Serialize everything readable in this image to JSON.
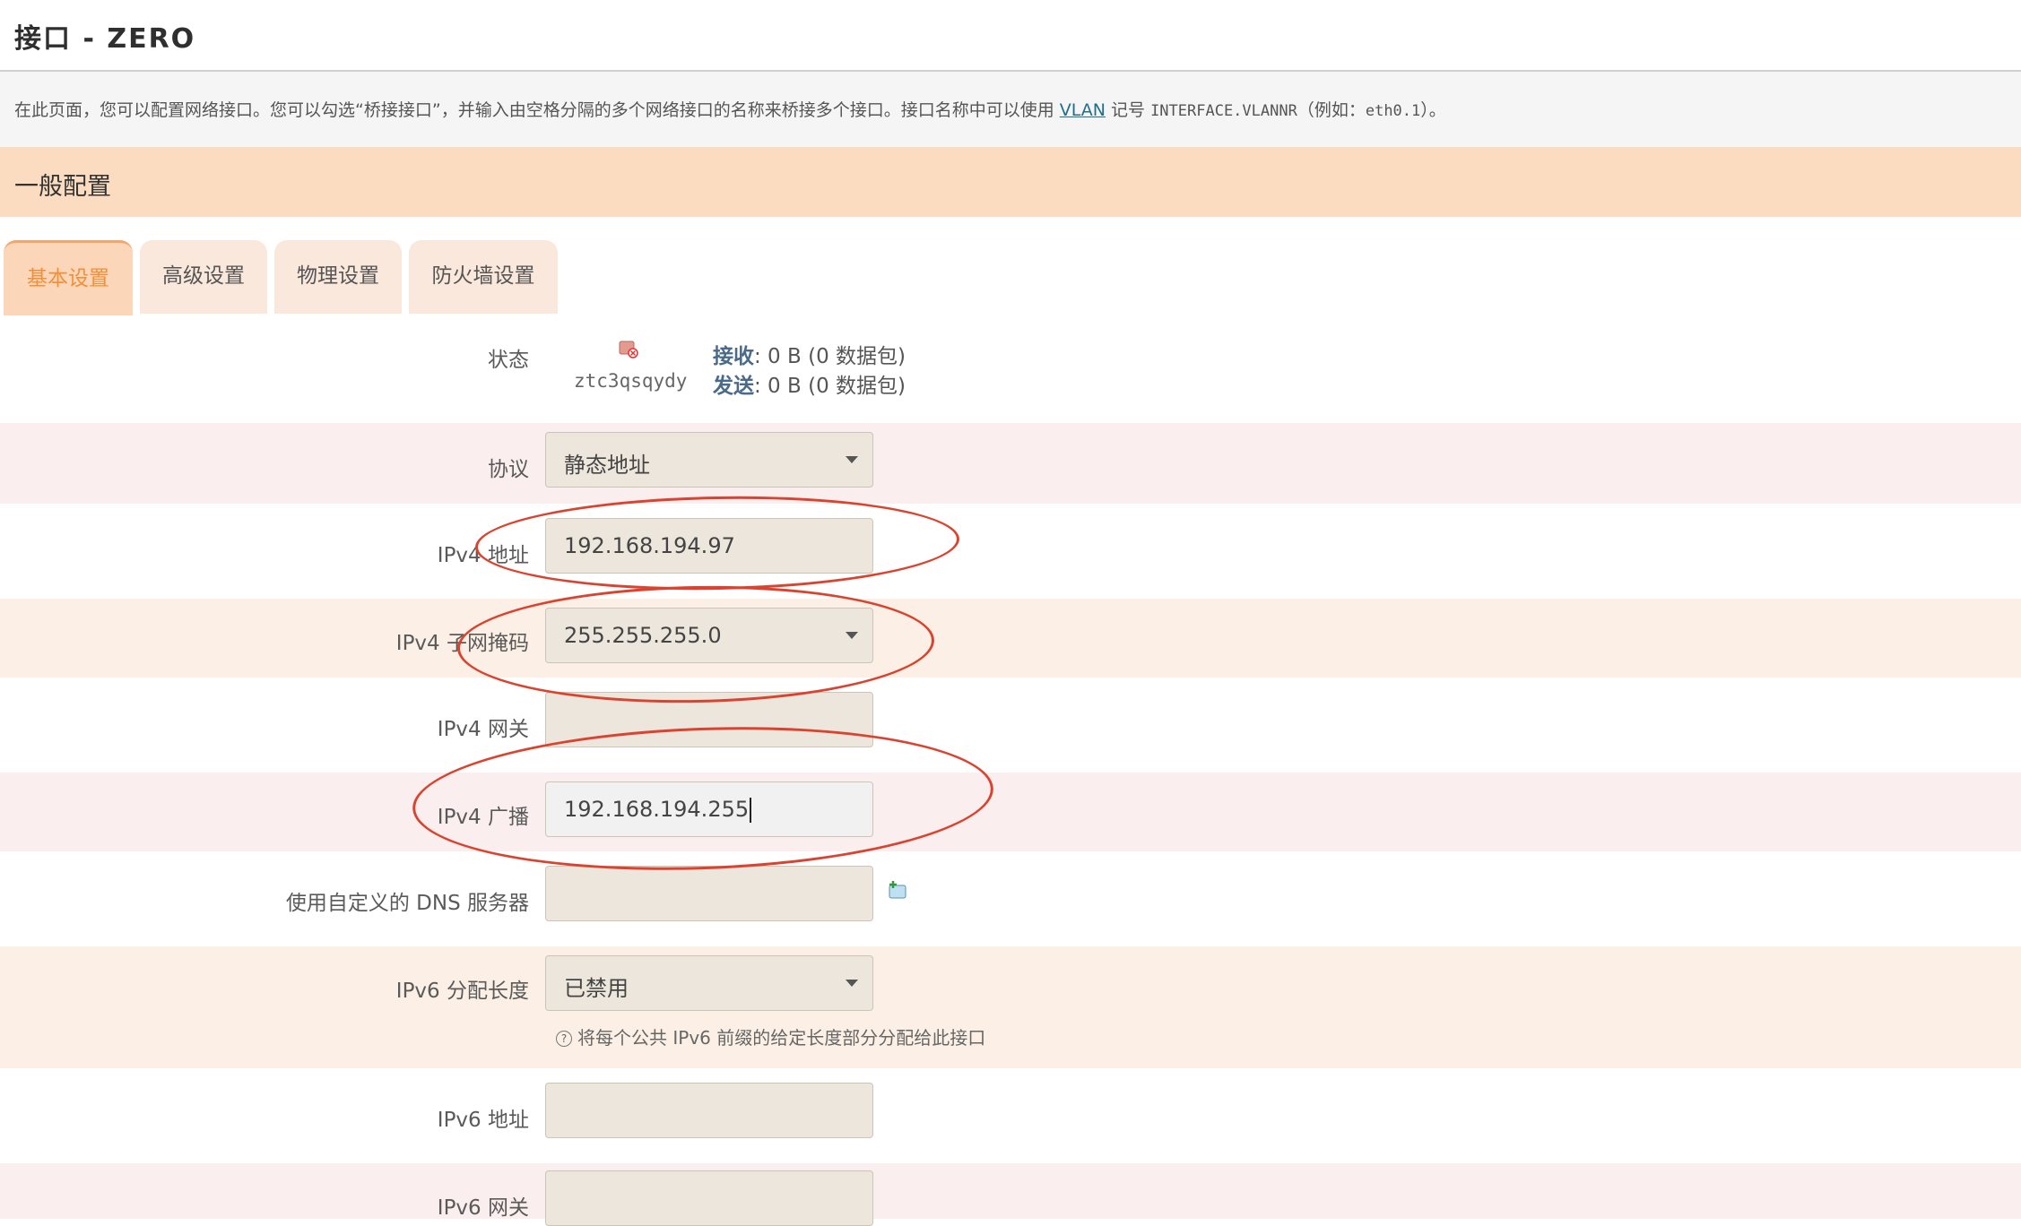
{
  "page": {
    "title": "接口 - ZERO",
    "description": {
      "part1": "在此页面，您可以配置网络接口。您可以勾选“桥接接口”，并输入由空格分隔的多个网络接口的名称来桥接多个接口。接口名称中可以使用 ",
      "vlan_link": "VLAN",
      "part2": " 记号 ",
      "code1": "INTERFACE.VLANNR",
      "part3": "（例如：",
      "code2": "eth0.1",
      "part4": "）。"
    },
    "section_title": "一般配置"
  },
  "tabs": [
    {
      "label": "基本设置",
      "active": true
    },
    {
      "label": "高级设置",
      "active": false
    },
    {
      "label": "物理设置",
      "active": false
    },
    {
      "label": "防火墙设置",
      "active": false
    }
  ],
  "status": {
    "label": "状态",
    "icon": "network-disconnected-icon",
    "interface_name": "ztc3qsqydy",
    "rx_label": "接收",
    "rx_value": ": 0 B (0 数据包)",
    "tx_label": "发送",
    "tx_value": ": 0 B (0 数据包)"
  },
  "form": {
    "protocol": {
      "label": "协议",
      "value": "静态地址"
    },
    "ipv4_address": {
      "label": "IPv4 地址",
      "value": "192.168.194.97"
    },
    "ipv4_netmask": {
      "label": "IPv4 子网掩码",
      "value": "255.255.255.0"
    },
    "ipv4_gateway": {
      "label": "IPv4 网关",
      "value": ""
    },
    "ipv4_broadcast": {
      "label": "IPv4 广播",
      "value": "192.168.194.255"
    },
    "custom_dns": {
      "label": "使用自定义的 DNS 服务器",
      "value": "",
      "add_icon": "add-entry-icon"
    },
    "ipv6_prefix_length": {
      "label": "IPv6 分配长度",
      "value": "已禁用",
      "hint_icon": "?",
      "hint": "将每个公共 IPv6 前缀的给定长度部分分配给此接口"
    },
    "ipv6_address": {
      "label": "IPv6 地址",
      "value": ""
    },
    "ipv6_gateway": {
      "label": "IPv6 网关",
      "value": ""
    }
  },
  "colors": {
    "section_bar": "#fbdcc0",
    "active_tab_text": "#f0903a",
    "annotation_ellipse": "#d9432f",
    "link": "#1f6f8b"
  }
}
